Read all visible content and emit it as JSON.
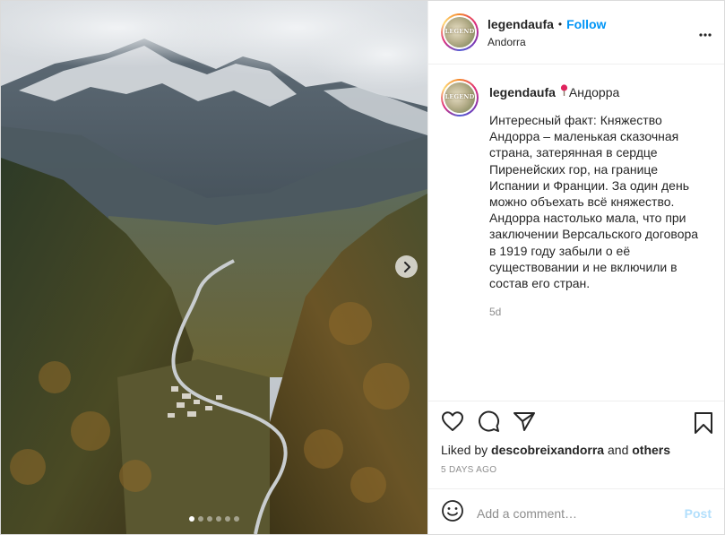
{
  "post": {
    "username": "legendaufa",
    "follow_label": "Follow",
    "separator": "•",
    "location": "Andorra",
    "avatar_text": "LEGEND",
    "caption": {
      "username": "legendaufa",
      "location_tag": "Андорра",
      "text": "Интересный факт: Княжество Андорра – маленькая сказочная страна, затерянная в сердце Пиренейских гор, на границе Испании и Франции. За один день можно объехать всё княжество. Андорра настолько мала, что при заключении Версальского договора в 1919 году забыли о её существовании и не включили в состав его стран.",
      "time": "5d"
    },
    "likes": {
      "prefix": "Liked by",
      "user": "descobreixandorra",
      "connector": "and",
      "others": "others"
    },
    "date": "5 DAYS AGO",
    "comment": {
      "placeholder": "Add a comment…",
      "post_label": "Post"
    },
    "carousel": {
      "count": 6,
      "active": 0
    },
    "icons": {
      "more": "more-options-icon",
      "like": "heart-icon",
      "comment": "comment-bubble-icon",
      "share": "paper-plane-icon",
      "save": "bookmark-icon",
      "emoji": "emoji-smile-icon",
      "next": "chevron-right-icon",
      "pin": "location-pin-icon"
    },
    "colors": {
      "accent": "#0095f6",
      "post_disabled": "#b2dffc",
      "muted": "#8e8e8e",
      "pin": "#e0245e"
    }
  }
}
